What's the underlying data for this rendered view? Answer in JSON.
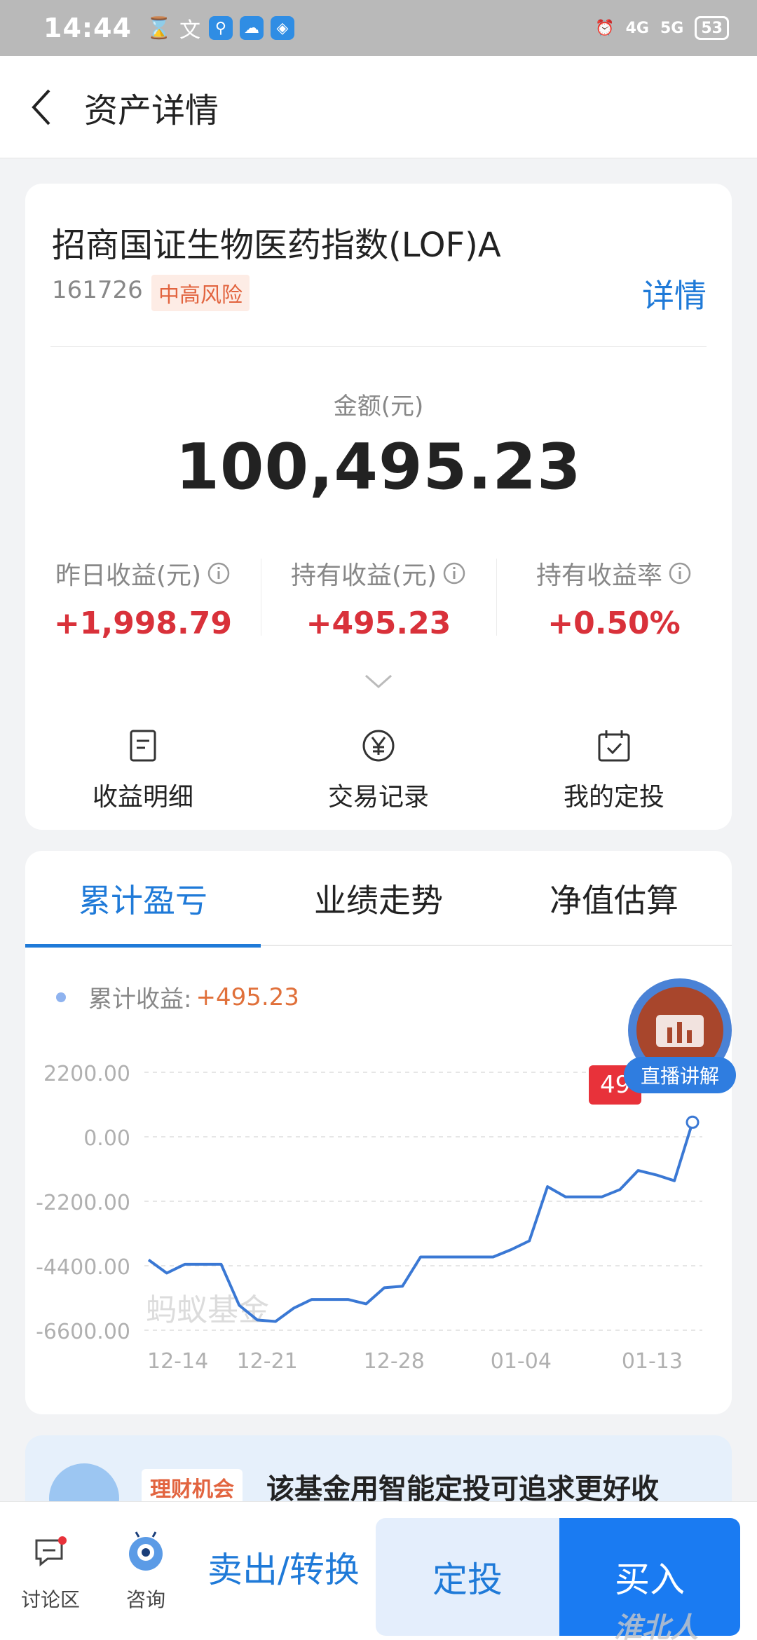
{
  "status_bar": {
    "time": "14:44",
    "battery": "53",
    "network1": "4G",
    "network2": "5G"
  },
  "nav": {
    "title": "资产详情"
  },
  "fund": {
    "name": "招商国证生物医药指数(LOF)A",
    "code": "161726",
    "risk": "中高风险",
    "detail_link": "详情",
    "amount_label": "金额(元)",
    "amount": "100,495.23"
  },
  "stats": [
    {
      "label": "昨日收益(元)",
      "value": "+1,998.79"
    },
    {
      "label": "持有收益(元)",
      "value": "+495.23"
    },
    {
      "label": "持有收益率",
      "value": "+0.50%"
    }
  ],
  "actions": [
    {
      "label": "收益明细",
      "icon": "document-icon"
    },
    {
      "label": "交易记录",
      "icon": "yen-circle-icon"
    },
    {
      "label": "我的定投",
      "icon": "calendar-check-icon"
    }
  ],
  "tabs": [
    {
      "label": "累计盈亏",
      "active": true
    },
    {
      "label": "业绩走势",
      "active": false
    },
    {
      "label": "净值估算",
      "active": false
    }
  ],
  "chart_legend": {
    "label": "累计收益:",
    "value": "+495.23"
  },
  "chart_watermark": "蚂蚁基金",
  "live": {
    "label": "直播讲解",
    "tooltip_visible": "49"
  },
  "chart_data": {
    "type": "line",
    "title": "",
    "xlabel": "",
    "ylabel": "",
    "x_tick_labels": [
      "12-14",
      "12-21",
      "12-28",
      "01-04",
      "01-13"
    ],
    "y_tick_labels": [
      "2200.00",
      "0.00",
      "-2200.00",
      "-4400.00",
      "-6600.00"
    ],
    "ylim": [
      -6600,
      2200
    ],
    "grid": true,
    "series": [
      {
        "values": [
          -4200,
          -4650,
          -4350,
          -4350,
          -4350,
          -5750,
          -6250,
          -6300,
          -5850,
          -5550,
          -5550,
          -5550,
          -5700,
          -5150,
          -5100,
          -4100,
          -4100,
          -4100,
          -4100,
          -4100,
          -3850,
          -3550,
          -1700,
          -2050,
          -2050,
          -2050,
          -1800,
          -1150,
          -1300,
          -1500,
          495.23
        ]
      }
    ],
    "color": "#3a78d4"
  },
  "promo": {
    "tag": "理财机会",
    "text": "该基金用智能定投可追求更好收"
  },
  "bottom_bar": {
    "discuss": "讨论区",
    "consult": "咨询",
    "sell": "卖出/转换",
    "fixed": "定投",
    "buy": "买入"
  },
  "watermark": "淮北人"
}
